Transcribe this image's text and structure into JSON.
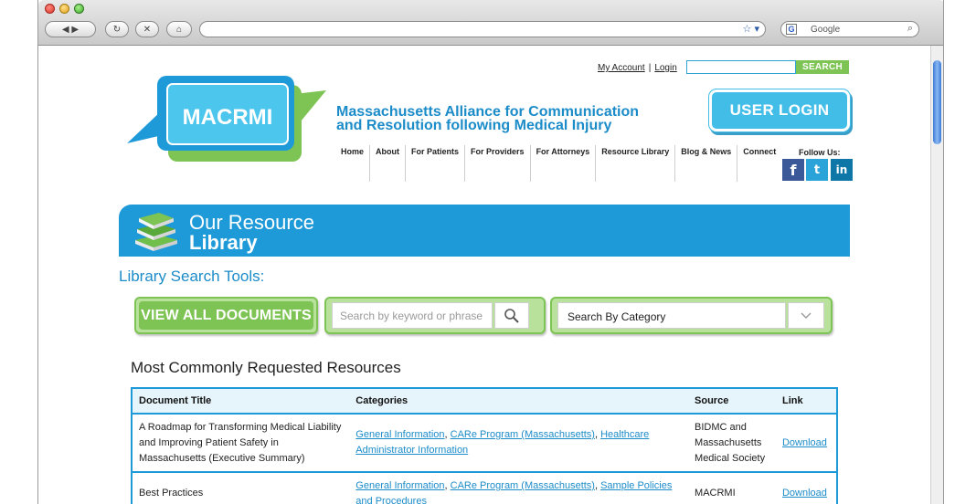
{
  "browser": {
    "search_placeholder": "Google",
    "back_glyph": "◀ ▶",
    "reload_glyph": "↻",
    "stop_glyph": "✕",
    "home_glyph": "⌂",
    "url_icons": "☆ ▾",
    "g_glyph": "G",
    "mag_glyph": "⌕"
  },
  "header": {
    "my_account": "My Account",
    "login_link": "Login",
    "separator": "|",
    "search_button": "SEARCH",
    "logo_text": "MACRMI",
    "org_line1": "Massachusetts Alliance for Communication",
    "org_line2": "and Resolution following Medical Injury",
    "user_login": "USER LOGIN"
  },
  "nav": {
    "items": [
      "Home",
      "About",
      "For Patients",
      "For Providers",
      "For Attorneys",
      "Resource Library",
      "Blog & News",
      "Connect"
    ],
    "follow_us": "Follow Us:",
    "social": [
      "f",
      "t",
      "in"
    ]
  },
  "banner": {
    "line1": "Our Resource",
    "line2": "Library"
  },
  "tools": {
    "title": "Library Search Tools:",
    "view_all": "VIEW ALL DOCUMENTS",
    "keyword_placeholder": "Search by keyword or phrase",
    "category": "Search By Category",
    "search_glyph": "🔍",
    "chevron_glyph": "⌄"
  },
  "resources": {
    "title": "Most Commonly Requested Resources",
    "columns": [
      "Document Title",
      "Categories",
      "Source",
      "Link"
    ],
    "rows": [
      {
        "title": "A Roadmap for Transforming Medical Liability and Improving Patient Safety in Massachusetts (Executive Summary)",
        "categories": [
          "General Information",
          "CARe Program (Massachusetts)",
          "Healthcare Administrator Information"
        ],
        "source": "BIDMC and Massachusetts Medical Society",
        "link": "Download"
      },
      {
        "title": "Best Practices",
        "categories": [
          "General Information",
          "CARe Program (Massachusetts)",
          "Sample Policies and Procedures"
        ],
        "source": "MACRMI",
        "link": "Download"
      }
    ],
    "cat_separator": ", "
  },
  "colors": {
    "brand_blue": "#1f9ad8",
    "brand_green": "#7ec454",
    "logo_cyan": "#41bde8"
  }
}
